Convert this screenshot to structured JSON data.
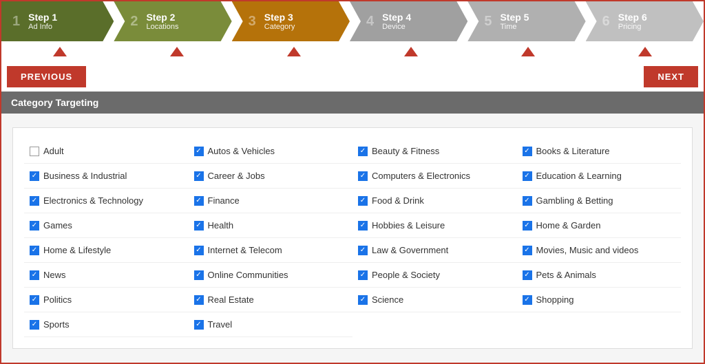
{
  "stepper": {
    "steps": [
      {
        "id": "step-1",
        "number": "Step 1",
        "label": "Ad Info",
        "colorClass": "step-1"
      },
      {
        "id": "step-2",
        "number": "Step 2",
        "label": "Locations",
        "colorClass": "step-2"
      },
      {
        "id": "step-3",
        "number": "Step 3",
        "label": "Category",
        "colorClass": "step-3"
      },
      {
        "id": "step-4",
        "number": "Step 4",
        "label": "Device",
        "colorClass": "step-4"
      },
      {
        "id": "step-5",
        "number": "Step 5",
        "label": "Time",
        "colorClass": "step-5"
      },
      {
        "id": "step-6",
        "number": "Step 6",
        "label": "Pricing",
        "colorClass": "step-6"
      }
    ]
  },
  "nav": {
    "prev_label": "PREVIOUS",
    "next_label": "NEXT"
  },
  "section": {
    "title": "Category Targeting"
  },
  "categories": [
    {
      "label": "Adult",
      "checked": false
    },
    {
      "label": "Autos & Vehicles",
      "checked": true
    },
    {
      "label": "Beauty & Fitness",
      "checked": true
    },
    {
      "label": "Books & Literature",
      "checked": true
    },
    {
      "label": "Business & Industrial",
      "checked": true
    },
    {
      "label": "Career & Jobs",
      "checked": true
    },
    {
      "label": "Computers & Electronics",
      "checked": true
    },
    {
      "label": "Education & Learning",
      "checked": true
    },
    {
      "label": "Electronics & Technology",
      "checked": true
    },
    {
      "label": "Finance",
      "checked": true
    },
    {
      "label": "Food & Drink",
      "checked": true
    },
    {
      "label": "Gambling & Betting",
      "checked": true
    },
    {
      "label": "Games",
      "checked": true
    },
    {
      "label": "Health",
      "checked": true
    },
    {
      "label": "Hobbies & Leisure",
      "checked": true
    },
    {
      "label": "Home & Garden",
      "checked": true
    },
    {
      "label": "Home & Lifestyle",
      "checked": true
    },
    {
      "label": "Internet & Telecom",
      "checked": true
    },
    {
      "label": "Law & Government",
      "checked": true
    },
    {
      "label": "Movies, Music and videos",
      "checked": true
    },
    {
      "label": "News",
      "checked": true
    },
    {
      "label": "Online Communities",
      "checked": true
    },
    {
      "label": "People & Society",
      "checked": true
    },
    {
      "label": "Pets & Animals",
      "checked": true
    },
    {
      "label": "Politics",
      "checked": true
    },
    {
      "label": "Real Estate",
      "checked": true
    },
    {
      "label": "Science",
      "checked": true
    },
    {
      "label": "Shopping",
      "checked": true
    },
    {
      "label": "Sports",
      "checked": true
    },
    {
      "label": "Travel",
      "checked": true
    }
  ]
}
